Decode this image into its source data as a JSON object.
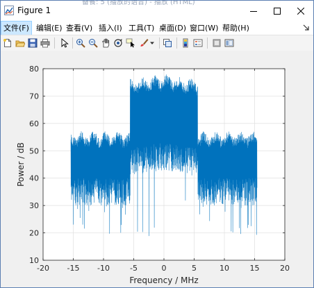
{
  "window": {
    "background_title": "备餐: 5 (播放的语音) - 播放 (HTML)",
    "title": "Figure 1",
    "controls": {
      "minimize": "minimize",
      "maximize": "maximize",
      "close": "close"
    }
  },
  "menu": {
    "items": [
      {
        "label": "文件(F)",
        "active": true
      },
      {
        "label": "编辑(E)"
      },
      {
        "label": "查看(V)"
      },
      {
        "label": "插入(I)"
      },
      {
        "label": "工具(T)"
      },
      {
        "label": "桌面(D)"
      },
      {
        "label": "窗口(W)"
      },
      {
        "label": "帮助(H)"
      }
    ]
  },
  "toolbar": {
    "icons": [
      "new-figure-icon",
      "open-file-icon",
      "save-icon",
      "print-icon",
      "edit-plot-arrow-icon",
      "zoom-in-icon",
      "zoom-out-icon",
      "pan-hand-icon",
      "rotate-3d-icon",
      "data-cursor-icon",
      "brush-icon",
      "link-plot-icon",
      "colorbar-icon",
      "legend-icon",
      "hide-plot-tools-icon",
      "show-plot-tools-icon"
    ]
  },
  "colors": {
    "series": "#0072bd",
    "axes_background": "#ffffff",
    "figure_background": "#f0f0f0",
    "grid": "#dfdfdf",
    "selected_menu": "#cce8ff"
  },
  "chart_data": {
    "type": "line",
    "title": "",
    "xlabel": "Frequency / MHz",
    "ylabel": "Power / dB",
    "xlim": [
      -20,
      20
    ],
    "ylim": [
      10,
      80
    ],
    "xticks": [
      -20,
      -15,
      -10,
      -5,
      0,
      5,
      10,
      15,
      20
    ],
    "yticks": [
      10,
      20,
      30,
      40,
      50,
      60,
      70,
      80
    ],
    "grid": true,
    "legend": "none",
    "series": [
      {
        "envelope": [
          {
            "band_mhz": [
              -15.4,
              -5.6
            ],
            "peak_db": 56,
            "typical_low_db": 35,
            "min_db": 19
          },
          {
            "band_mhz": [
              -5.6,
              5.6
            ],
            "peak_db": 77,
            "typical_low_db": 48,
            "min_db": 16
          },
          {
            "band_mhz": [
              5.6,
              15.4
            ],
            "peak_db": 56,
            "typical_low_db": 35,
            "min_db": 19
          }
        ],
        "x_range_mhz": [
          -15.4,
          15.4
        ]
      }
    ]
  }
}
